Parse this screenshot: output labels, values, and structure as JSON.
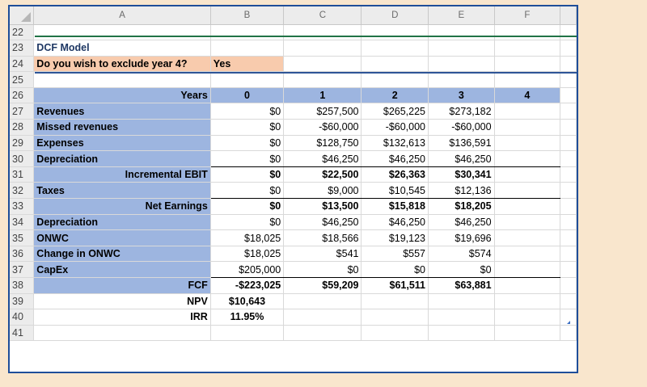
{
  "columns": [
    "A",
    "B",
    "C",
    "D",
    "E",
    "F"
  ],
  "title": "DCF Model",
  "question": {
    "label": "Do you wish to exclude year 4?",
    "value": "Yes"
  },
  "rows": [
    {
      "n": "22"
    },
    {
      "n": "23"
    },
    {
      "n": "24"
    },
    {
      "n": "25"
    },
    {
      "n": "26",
      "a": "Years",
      "b": "0",
      "c": "1",
      "d": "2",
      "e": "3",
      "f": "4"
    },
    {
      "n": "27",
      "a": "Revenues",
      "b": "$0",
      "c": "$257,500",
      "d": "$265,225",
      "e": "$273,182"
    },
    {
      "n": "28",
      "a": "Missed revenues",
      "b": "$0",
      "c": "-$60,000",
      "d": "-$60,000",
      "e": "-$60,000"
    },
    {
      "n": "29",
      "a": "Expenses",
      "b": "$0",
      "c": "$128,750",
      "d": "$132,613",
      "e": "$136,591"
    },
    {
      "n": "30",
      "a": "Depreciation",
      "b": "$0",
      "c": "$46,250",
      "d": "$46,250",
      "e": "$46,250"
    },
    {
      "n": "31",
      "a": "Incremental EBIT",
      "b": "$0",
      "c": "$22,500",
      "d": "$26,363",
      "e": "$30,341"
    },
    {
      "n": "32",
      "a": "Taxes",
      "b": "$0",
      "c": "$9,000",
      "d": "$10,545",
      "e": "$12,136"
    },
    {
      "n": "33",
      "a": "Net Earnings",
      "b": "$0",
      "c": "$13,500",
      "d": "$15,818",
      "e": "$18,205"
    },
    {
      "n": "34",
      "a": "Depreciation",
      "b": "$0",
      "c": "$46,250",
      "d": "$46,250",
      "e": "$46,250"
    },
    {
      "n": "35",
      "a": "ONWC",
      "b": "$18,025",
      "c": "$18,566",
      "d": "$19,123",
      "e": "$19,696"
    },
    {
      "n": "36",
      "a": "Change in ONWC",
      "b": "$18,025",
      "c": "$541",
      "d": "$557",
      "e": "$574"
    },
    {
      "n": "37",
      "a": "CapEx",
      "b": "$205,000",
      "c": "$0",
      "d": "$0",
      "e": "$0"
    },
    {
      "n": "38",
      "a": "FCF",
      "b": "-$223,025",
      "c": "$59,209",
      "d": "$61,511",
      "e": "$63,881"
    },
    {
      "n": "39",
      "a": "NPV",
      "b": "$10,643"
    },
    {
      "n": "40",
      "a": "IRR",
      "b": "11.95%"
    },
    {
      "n": "41"
    }
  ],
  "colors": {
    "label_fill": "#9db5e0",
    "question_fill": "#f8cbad",
    "title_color": "#1f3864",
    "frame": "#1f4e99",
    "background": "#f9e6cd"
  }
}
